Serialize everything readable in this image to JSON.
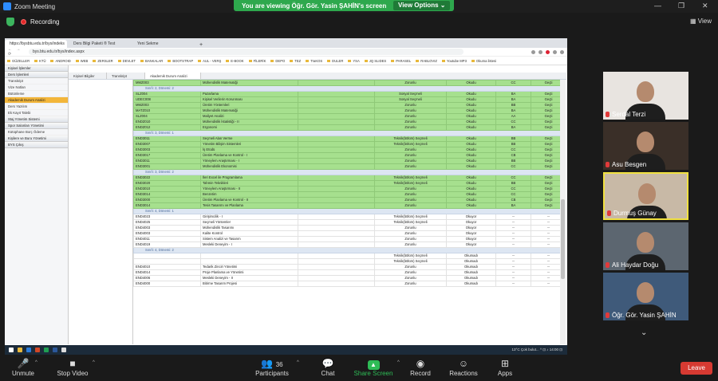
{
  "zoom": {
    "title": "Zoom Meeting",
    "banner_text": "You are viewing Öğr. Gör. Yasin ŞAHİN's screen",
    "view_options": "View Options",
    "recording": "Recording",
    "view": "View",
    "leave": "Leave"
  },
  "browser": {
    "tabs": [
      "https://bysbtu.edu.tr/bys/indeks",
      "Ders Bilgi Paketi ® Test",
      "Yeni Sekme"
    ],
    "url": "bys.btu.edu.tr/bys/index.aspx",
    "bookmarks": [
      "GÜZELLER",
      "KTÜ",
      "ANDROID",
      "WEB",
      "ZERSLER",
      "DEVLET",
      "BANKALAR",
      "BOOTSTRAP",
      "AUL - VERŞ",
      "E-BOOK",
      "FİLERİK",
      "DEPO",
      "TEZ",
      "TraKOS",
      "DULER",
      "YSA",
      "JQ SLIDES",
      "PARASEL",
      "RABLOVIZ",
      "Youtube MP3"
    ],
    "bookmark_end": "Okuma listesi"
  },
  "sidebar": {
    "items": [
      {
        "label": "Kişisel İşlemler",
        "type": "section"
      },
      {
        "label": "Ders İşlemleri",
        "type": "section"
      },
      {
        "label": "Transkript",
        "type": "item"
      },
      {
        "label": "Vize Notları",
        "type": "item"
      },
      {
        "label": "Bütünleme",
        "type": "item"
      },
      {
        "label": "Akademik Durum Analizi",
        "type": "selected"
      },
      {
        "label": "Ders Yazılım",
        "type": "item"
      },
      {
        "label": "Ek Kayıt Talebi",
        "type": "item"
      },
      {
        "label": "Staj Yönetim Sistemi",
        "type": "section"
      },
      {
        "label": "Spor Salonları Yönetimi",
        "type": "section"
      },
      {
        "label": "Kütüphane Borç Ödeme",
        "type": "item"
      },
      {
        "label": "Kişilere ve Buru Yönetimi",
        "type": "section"
      },
      {
        "label": "BYS Çıkış",
        "type": "section"
      }
    ]
  },
  "content_tabs": [
    "Kişisel Bilgiler",
    "Transkript",
    "Akademik Durum Analizi"
  ],
  "grid": {
    "rows": [
      {
        "k": "g",
        "c": [
          "MMZ003",
          "Mühendislik Matematiği",
          "",
          "Zorunlu",
          "Okudu",
          "CC",
          "Geçti"
        ]
      },
      {
        "k": "grp",
        "c": [
          "Sınıfı: 2, Dönemi: 2"
        ]
      },
      {
        "k": "g",
        "c": [
          "SLZ004",
          "Pazarlama",
          "",
          "Sosyal Seçmeli",
          "Okudu",
          "BA",
          "Geçti"
        ]
      },
      {
        "k": "g",
        "c": [
          "UDEC008",
          "Kişisel Verilerin Korunması",
          "",
          "Sosyal Seçmeli",
          "Okudu",
          "BA",
          "Geçti"
        ]
      },
      {
        "k": "g",
        "c": [
          "MMZ003",
          "Üretim Yöntemleri",
          "",
          "Zorunlu",
          "Okudu",
          "BB",
          "Geçti"
        ]
      },
      {
        "k": "g",
        "c": [
          "MATZ010",
          "Mühendislik Matematiği",
          "",
          "Zorunlu",
          "Okudu",
          "BA",
          "Geçti"
        ]
      },
      {
        "k": "g",
        "c": [
          "SLZ004",
          "Maliyet Analizi",
          "",
          "Zorunlu",
          "Okudu",
          "AA",
          "Geçti"
        ]
      },
      {
        "k": "g",
        "c": [
          "ENDZ010",
          "Mühendislik İstatistiği - II",
          "",
          "Zorunlu",
          "Okudu",
          "CC",
          "Geçti"
        ]
      },
      {
        "k": "g",
        "c": [
          "ENDZ012",
          "Ergonomi",
          "",
          "Zorunlu",
          "Okudu",
          "BA",
          "Geçti"
        ]
      },
      {
        "k": "grp",
        "c": [
          "Sınıfı: 3, Dönemi: 1"
        ]
      },
      {
        "k": "g",
        "c": [
          "END3011",
          "Seçmeli Alan Verme",
          "",
          "Teknik(bölüm) Seçmeli",
          "Okudu",
          "BB",
          "Geçti"
        ]
      },
      {
        "k": "g",
        "c": [
          "END3007",
          "Yönetim Bilişim Sistemleri",
          "",
          "Teknik(bölüm) Seçmeli",
          "Okudu",
          "BB",
          "Geçti"
        ]
      },
      {
        "k": "g",
        "c": [
          "END3003",
          "İş Etüdü",
          "",
          "Zorunlu",
          "Okudu",
          "CC",
          "Geçti"
        ]
      },
      {
        "k": "g",
        "c": [
          "END3017",
          "Üretim Planlama ve Kontrol - I",
          "",
          "Zorunlu",
          "Okudu",
          "CB",
          "Geçti"
        ]
      },
      {
        "k": "g",
        "c": [
          "END3011",
          "Yöneylem Araştırması - I",
          "",
          "Zorunlu",
          "Okudu",
          "BB",
          "Geçti"
        ]
      },
      {
        "k": "g",
        "c": [
          "END3001",
          "Mühendislik Ekonomisi",
          "",
          "Zorunlu",
          "Okudu",
          "CC",
          "Geçti"
        ]
      },
      {
        "k": "grp",
        "c": [
          "Sınıfı: 3, Dönemi: 2"
        ]
      },
      {
        "k": "g",
        "c": [
          "END3022",
          "İleri Excel ile Programlama",
          "",
          "Teknik(bölüm) Seçmeli",
          "Okudu",
          "CC",
          "Geçti"
        ]
      },
      {
        "k": "g",
        "c": [
          "END3020",
          "Tahmin Teknikleri",
          "",
          "Teknik(bölüm) Seçmeli",
          "Okudu",
          "BB",
          "Geçti"
        ]
      },
      {
        "k": "g",
        "c": [
          "END3010",
          "Yöneylem Araştırması - II",
          "",
          "Zorunlu",
          "Okudu",
          "CC",
          "Geçti"
        ]
      },
      {
        "k": "g",
        "c": [
          "END3014",
          "Benzetim",
          "",
          "Zorunlu",
          "Okudu",
          "CC",
          "Geçti"
        ]
      },
      {
        "k": "g",
        "c": [
          "END3000",
          "Üretim Planlama ve Kontrol - II",
          "",
          "Zorunlu",
          "Okudu",
          "CB",
          "Geçti"
        ]
      },
      {
        "k": "g",
        "c": [
          "END3014",
          "Tesis Tasarımı ve Planlama",
          "",
          "Zorunlu",
          "Okudu",
          "BA",
          "Geçti"
        ]
      },
      {
        "k": "grp",
        "c": [
          "Sınıfı: 4, Dönemi: 1"
        ]
      },
      {
        "k": "w",
        "c": [
          "END4023",
          "Girişimcilik - I",
          "",
          "Teknik(bölüm) Seçmeli",
          "Okuyor",
          "--",
          "--"
        ]
      },
      {
        "k": "w",
        "c": [
          "END4025",
          "Seçmeli Yöntemler",
          "",
          "Teknik(bölüm) Seçmeli",
          "Okuyor",
          "--",
          "--"
        ]
      },
      {
        "k": "w",
        "c": [
          "END4003",
          "Mühendislik Tasarımı",
          "",
          "Zorunlu",
          "Okuyor",
          "--",
          "--"
        ]
      },
      {
        "k": "w",
        "c": [
          "END4003",
          "Kalite Kontrol",
          "",
          "Zorunlu",
          "Okuyor",
          "--",
          "--"
        ]
      },
      {
        "k": "w",
        "c": [
          "END4011",
          "Sistem Analizi ve Tasarım",
          "",
          "Zorunlu",
          "Okuyor",
          "--",
          "--"
        ]
      },
      {
        "k": "w",
        "c": [
          "END4019",
          "Mesleki Deneyim - I",
          "",
          "Zorunlu",
          "Okuyor",
          "--",
          "--"
        ]
      },
      {
        "k": "grp",
        "c": [
          "Sınıfı: 4, Dönemi: 2"
        ]
      },
      {
        "k": "w",
        "c": [
          "",
          "",
          "",
          "Teknik(bölüm) Seçmeli",
          "Okumadı",
          "--",
          "--"
        ]
      },
      {
        "k": "w",
        "c": [
          "",
          "",
          "",
          "Teknik(bölüm) Seçmeli",
          "Okumadı",
          "--",
          "--"
        ]
      },
      {
        "k": "w",
        "c": [
          "END4010",
          "Tedarik Zinciri Yönetimi",
          "",
          "Zorunlu",
          "Okumadı",
          "--",
          "--"
        ]
      },
      {
        "k": "w",
        "c": [
          "END4014",
          "Proje Planlama ve Yönetimi",
          "",
          "Zorunlu",
          "Okumadı",
          "--",
          "--"
        ]
      },
      {
        "k": "w",
        "c": [
          "END4006",
          "Mesleki Deneyim - II",
          "",
          "Zorunlu",
          "Okumadı",
          "--",
          "--"
        ]
      },
      {
        "k": "w",
        "c": [
          "END4000",
          "Bitirme Tasarım Projesi",
          "",
          "Zorunlu",
          "Okumadı",
          "--",
          "--"
        ]
      }
    ]
  },
  "taskbar": {
    "tray": "13°C  Çok bulut...  ^  ⊡  ♪  14:00  ⊡"
  },
  "participants": [
    {
      "name": "Serdal Terzi",
      "bg": "#e8e4e0"
    },
    {
      "name": "Asu Besgen",
      "bg": "#3a2f28"
    },
    {
      "name": "Durmuş Günay",
      "bg": "#c8b9a6",
      "active": true
    },
    {
      "name": "Ali Haydar Doğu",
      "bg": "#5c6670"
    },
    {
      "name": "Öğr. Gör. Yasin ŞAHİN",
      "bg": "#3f5a7a"
    }
  ],
  "toolbar": {
    "unmute": "Unmute",
    "stop_video": "Stop Video",
    "participants": "Participants",
    "participants_count": "36",
    "chat": "Chat",
    "share_screen": "Share Screen",
    "record": "Record",
    "reactions": "Reactions",
    "apps": "Apps"
  }
}
